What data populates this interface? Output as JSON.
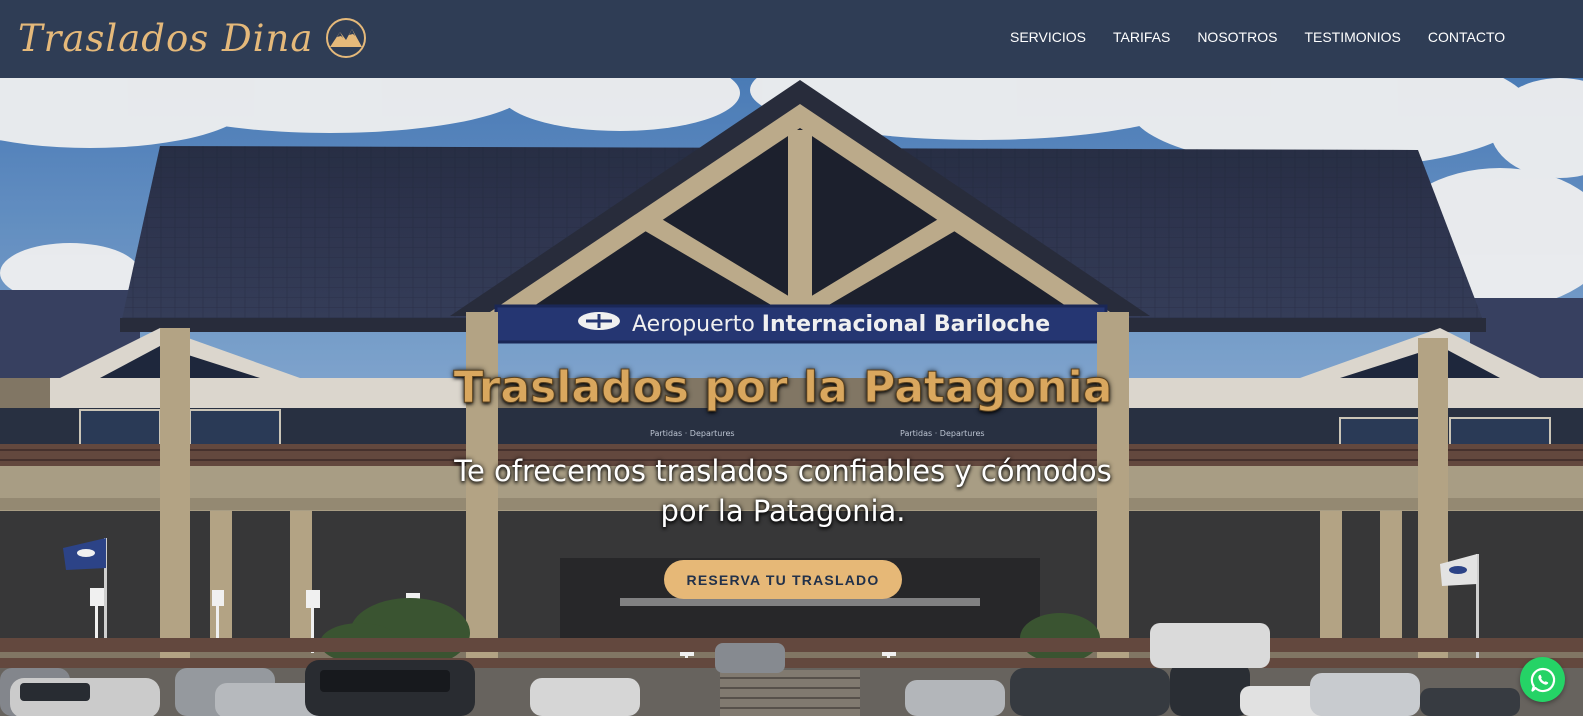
{
  "brand": {
    "name": "Traslados Dina",
    "logo_icon": "mountain-logo-icon"
  },
  "nav": {
    "items": [
      {
        "label": "SERVICIOS"
      },
      {
        "label": "TARIFAS"
      },
      {
        "label": "NOSOTROS"
      },
      {
        "label": "TESTIMONIOS"
      },
      {
        "label": "CONTACTO"
      }
    ]
  },
  "hero": {
    "sign_text_light": "Aeropuerto",
    "sign_text_bold": "Internacional Bariloche",
    "title": "Traslados por la Patagonia",
    "subtitle": "Te ofrecemos traslados confiables y cómodos por la Patagonia.",
    "cta_label": "RESERVA TU TRASLADO",
    "terminal_sign_1": "Partidas · Departures",
    "terminal_sign_2": "Partidas · Departures"
  },
  "floating": {
    "whatsapp_icon": "whatsapp-icon"
  },
  "colors": {
    "navbar_bg": "#2f3d55",
    "accent": "#e6b877",
    "title_gold": "#d9a75e",
    "whatsapp_green": "#25d366"
  }
}
